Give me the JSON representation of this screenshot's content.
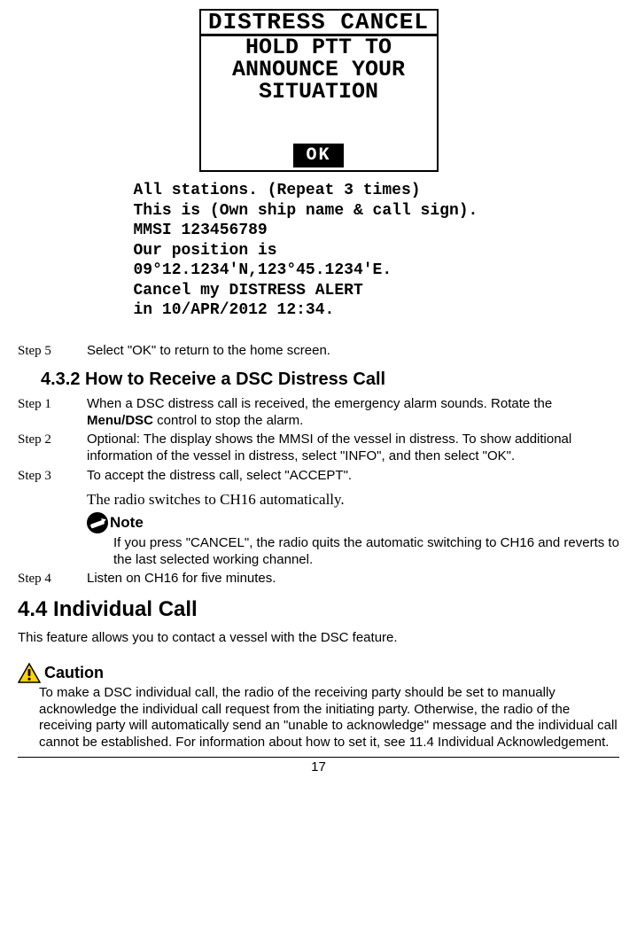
{
  "lcd": {
    "title": "DISTRESS CANCEL",
    "body": "HOLD PTT TO\nANNOUNCE YOUR\nSITUATION",
    "softkey": "OK"
  },
  "announcement": "All stations. (Repeat 3 times)\nThis is (Own ship name & call sign).\nMMSI 123456789\nOur position is\n09°12.1234'N,123°45.1234'E.\nCancel my DISTRESS ALERT\nin 10/APR/2012 12:34.",
  "step5": {
    "label": "Step 5",
    "text": "Select \"OK\" to return to the home screen."
  },
  "heading_432": "4.3.2 How to Receive a DSC Distress Call",
  "steps_432": [
    {
      "label": "Step 1",
      "pre": "When a DSC distress call is received, the emergency alarm sounds. Rotate the ",
      "bold": "Menu/DSC",
      "post": " control to stop the alarm."
    },
    {
      "label": "Step 2",
      "text": "Optional: The display shows the MMSI of the vessel in distress. To show additional information of the vessel in distress, select \"INFO\", and then select \"OK\"."
    },
    {
      "label": "Step 3",
      "text": "To accept the distress call, select \"ACCEPT\"."
    }
  ],
  "switch_text": "The radio switches to CH16 automatically.",
  "note": {
    "title": "Note",
    "body": "If you press \"CANCEL\", the radio quits the automatic switching to CH16 and reverts to the last selected working channel."
  },
  "step4": {
    "label": "Step 4",
    "text": "Listen on CH16 for five minutes."
  },
  "heading_44": "4.4 Individual Call",
  "intro_44": "This feature allows you to contact a vessel with the DSC feature.",
  "caution": {
    "title": "Caution",
    "body": "To make a DSC individual call, the radio of the receiving party should be set to manually acknowledge the individual call request from the initiating party. Otherwise, the radio of the receiving party will automatically send an \"unable to acknowledge\" message and the individual call cannot be established. For information about how to set it, see 11.4 Individual Acknowledgement."
  },
  "page_number": "17"
}
